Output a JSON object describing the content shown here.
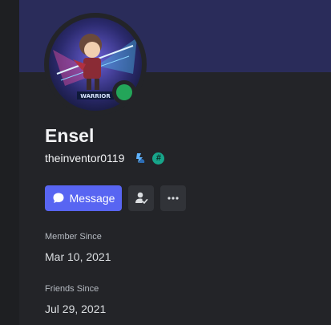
{
  "profile": {
    "display_name": "Ensel",
    "username": "theinventor0119",
    "status": "online",
    "status_color": "#23a559",
    "accent_color": "#5865f2",
    "avatar_caption": "WARRIOR",
    "badges": [
      "boost-badge-icon",
      "hashtag-badge-icon"
    ]
  },
  "actions": {
    "message_label": "Message",
    "friend_icon": "friend-check-icon",
    "more_icon": "more-dots-icon"
  },
  "sections": {
    "member_since_label": "Member Since",
    "member_since_value": "Mar 10, 2021",
    "friends_since_label": "Friends Since",
    "friends_since_value": "Jul 29, 2021"
  }
}
